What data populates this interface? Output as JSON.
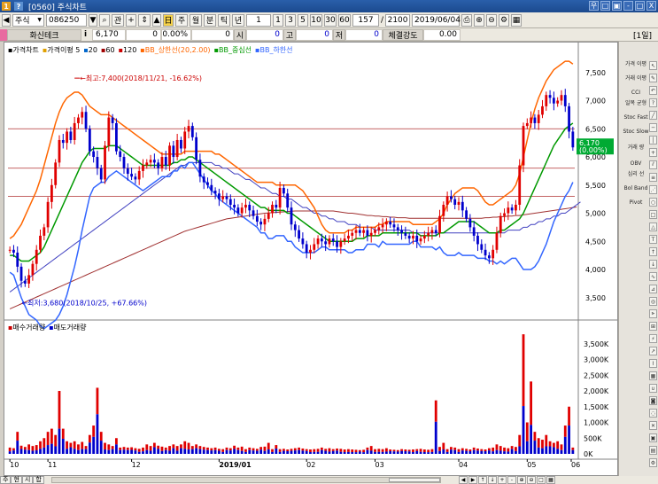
{
  "window": {
    "title": "[0560] 주식차트",
    "icon1": "1",
    "icon2": "?",
    "controls": [
      "우",
      "□",
      "▣",
      "-",
      "□",
      "X"
    ]
  },
  "toolbar1": {
    "market_select": "주식",
    "code": "086250",
    "search_label": "관",
    "btn_prev": "▲",
    "period_buttons": [
      "주",
      "월",
      "분",
      "틱",
      "년"
    ],
    "interval_value": "1",
    "interval_buttons": [
      "1",
      "3",
      "5",
      "10",
      "30",
      "60"
    ],
    "count_value": "157",
    "total_value": "2100",
    "date_value": "2019/06/04"
  },
  "toolbar2": {
    "name": "화신테크",
    "info_icon": "i",
    "price": "6,170",
    "change": "0",
    "change_pct": "0.00%",
    "volume": "0",
    "open_label": "시",
    "open_value": "0",
    "high_label": "고",
    "high_value": "0",
    "low_label": "저",
    "low_value": "0",
    "strength_label": "체결강도",
    "strength_value": "0.00",
    "period_badge": "[1일]"
  },
  "legend": {
    "items": [
      "가격차트",
      "가격이평 5",
      "20",
      "60",
      "120",
      "BB_상한선(20,2.00)",
      "BB_중심선",
      "BB_하한선"
    ],
    "colors": [
      "#000000",
      "#e0a000",
      "#0066cc",
      "#a00000",
      "#cc0000",
      "#ff6600",
      "#009900",
      "#3366ff"
    ]
  },
  "annotations": {
    "high": "최고:7,400(2018/11/21, -16.62%)",
    "low": "최저:3,680(2018/10/25, +67.66%)",
    "current_price": "6,170",
    "current_pct": "(0.00%)"
  },
  "price_axis": [
    "7,500",
    "7,000",
    "6,500",
    "6,000",
    "5,500",
    "5,000",
    "4,500",
    "4,000",
    "3,500"
  ],
  "volume_axis": [
    "3,500K",
    "3,000K",
    "2,500K",
    "2,000K",
    "1,500K",
    "1,000K",
    "500K",
    "0K"
  ],
  "volume_legend": [
    "매수거래량",
    "매도거래량"
  ],
  "x_axis": [
    "10",
    "11",
    "12",
    "2019/01",
    "02",
    "03",
    "04",
    "05",
    "06"
  ],
  "right_panel": {
    "items": [
      "가격 이평",
      "거래 이평",
      "CCI",
      "일목 균형",
      "Stoc Fast",
      "Stoc Slow",
      "거래 량",
      "OBV",
      "심리 선",
      "Bol Band",
      "Pivot"
    ]
  },
  "bottom": {
    "tabs": [
      "주",
      "현",
      "시",
      "합"
    ],
    "controls": [
      "◀",
      "▶",
      "↑",
      "↓",
      "+",
      "-",
      "⊕",
      "⊖",
      "□",
      "▦"
    ]
  },
  "chart_data": {
    "type": "candlestick",
    "title": "",
    "ylim": [
      3150,
      7780
    ],
    "volume_ylim": [
      0,
      4000
    ],
    "x_labels": [
      "10",
      "11",
      "12",
      "2019/01",
      "02",
      "03",
      "04",
      "05",
      "06"
    ],
    "closes": [
      4350,
      4300,
      4050,
      3800,
      3750,
      3900,
      4100,
      4350,
      4600,
      4750,
      5200,
      5500,
      5900,
      6300,
      6250,
      6450,
      6300,
      6600,
      6700,
      6800,
      6500,
      6100,
      6000,
      5800,
      5600,
      6200,
      6700,
      6600,
      6100,
      6000,
      5800,
      5700,
      5650,
      5600,
      5750,
      5850,
      5900,
      5950,
      5900,
      5800,
      6000,
      5850,
      6200,
      6000,
      6300,
      6150,
      6450,
      6550,
      6350,
      5950,
      5650,
      5550,
      5500,
      5400,
      5350,
      5250,
      5300,
      5250,
      5150,
      5100,
      5000,
      5100,
      5150,
      5050,
      4950,
      4850,
      4800,
      4900,
      5000,
      5150,
      5100,
      5450,
      5350,
      5100,
      4800,
      4700,
      4550,
      4450,
      4300,
      4350,
      4450,
      4550,
      4500,
      4450,
      4550,
      4500,
      4400,
      4500,
      4550,
      4600,
      4650,
      4700,
      4650,
      4700,
      4600,
      4650,
      4700,
      4750,
      4800,
      4850,
      4800,
      4750,
      4700,
      4650,
      4600,
      4550,
      4600,
      4500,
      4550,
      4600,
      4650,
      4700,
      4650,
      4950,
      5150,
      5300,
      5250,
      5150,
      5200,
      5050,
      4900,
      4750,
      4600,
      4450,
      4350,
      4250,
      4200,
      4350,
      4650,
      4950,
      5000,
      5100,
      5050,
      5150,
      5850,
      6550,
      6600,
      6700,
      6600,
      6750,
      6900,
      7100,
      7050,
      6950,
      7000,
      7100,
      6900,
      6450,
      6170
    ],
    "volumes": [
      200,
      180,
      700,
      260,
      220,
      300,
      250,
      280,
      400,
      500,
      700,
      800,
      600,
      2000,
      800,
      400,
      350,
      400,
      300,
      380,
      250,
      600,
      900,
      2100,
      700,
      350,
      300,
      250,
      500,
      200,
      220,
      200,
      210,
      180,
      160,
      200,
      300,
      250,
      350,
      260,
      230,
      200,
      250,
      300,
      250,
      300,
      400,
      350,
      250,
      300,
      250,
      220,
      200,
      180,
      200,
      160,
      150,
      200,
      180,
      260,
      200,
      230,
      150,
      200,
      180,
      160,
      220,
      230,
      350,
      150,
      280,
      150,
      160,
      140,
      160,
      180,
      200,
      170,
      150,
      140,
      150,
      160,
      200,
      160,
      180,
      150,
      170,
      160,
      140,
      150,
      140,
      130,
      120,
      130,
      200,
      250,
      150,
      160,
      150,
      180,
      140,
      130,
      120,
      150,
      140,
      130,
      140,
      150,
      160,
      140,
      130,
      150,
      1700,
      220,
      350,
      150,
      220,
      200,
      150,
      180,
      160,
      140,
      200,
      170,
      150,
      140,
      180,
      200,
      300,
      250,
      200,
      180,
      250,
      220,
      600,
      3800,
      1000,
      2300,
      700,
      500,
      450,
      600,
      400,
      350,
      400,
      300,
      900,
      1500,
      200
    ],
    "bb_upper": [
      4550,
      4600,
      4700,
      4800,
      4950,
      5100,
      5250,
      5400,
      5600,
      5850,
      6100,
      6350,
      6600,
      6800,
      6950,
      7050,
      7100,
      7150,
      7150,
      7100,
      7000,
      6900,
      6850,
      6800,
      6750,
      6750,
      6750,
      6700,
      6650,
      6600,
      6550,
      6500,
      6450,
      6400,
      6350,
      6300,
      6250,
      6200,
      6150,
      6100,
      6050,
      6050,
      6050,
      6050,
      6050,
      6050,
      6100,
      6100,
      6100,
      6100,
      6100,
      6100,
      6100,
      6100,
      6050,
      6050,
      6000,
      5950,
      5900,
      5850,
      5800,
      5750,
      5700,
      5650,
      5600,
      5550,
      5550,
      5550,
      5550,
      5550,
      5500,
      5500,
      5500,
      5500,
      5500,
      5500,
      5450,
      5400,
      5300,
      5200,
      5100,
      4950,
      4800,
      4700,
      4650,
      4650,
      4650,
      4650,
      4650,
      4700,
      4700,
      4750,
      4750,
      4750,
      4750,
      4750,
      4750,
      4800,
      4800,
      4850,
      4850,
      4850,
      4850,
      4850,
      4850,
      4850,
      4800,
      4800,
      4800,
      4800,
      4800,
      4800,
      4850,
      4900,
      5000,
      5150,
      5250,
      5350,
      5400,
      5450,
      5450,
      5450,
      5450,
      5400,
      5300,
      5200,
      5150,
      5150,
      5200,
      5250,
      5300,
      5350,
      5400,
      5500,
      5700,
      6000,
      6300,
      6600,
      6850,
      7050,
      7200,
      7350,
      7450,
      7550,
      7600,
      7650,
      7700,
      7700,
      7650
    ],
    "bb_mid": [
      4250,
      4250,
      4200,
      4150,
      4150,
      4150,
      4200,
      4250,
      4300,
      4400,
      4550,
      4700,
      4850,
      5000,
      5150,
      5300,
      5450,
      5600,
      5750,
      5900,
      6000,
      6100,
      6150,
      6150,
      6150,
      6150,
      6200,
      6200,
      6200,
      6150,
      6100,
      6050,
      6000,
      5950,
      5900,
      5850,
      5850,
      5850,
      5850,
      5850,
      5850,
      5850,
      5850,
      5900,
      5900,
      5950,
      5950,
      6000,
      6000,
      5950,
      5900,
      5850,
      5800,
      5750,
      5700,
      5650,
      5600,
      5550,
      5500,
      5450,
      5400,
      5350,
      5300,
      5250,
      5200,
      5150,
      5100,
      5100,
      5050,
      5050,
      5050,
      5050,
      5050,
      5000,
      5000,
      4950,
      4900,
      4850,
      4800,
      4750,
      4700,
      4650,
      4600,
      4550,
      4500,
      4500,
      4500,
      4500,
      4500,
      4500,
      4500,
      4550,
      4550,
      4550,
      4600,
      4600,
      4600,
      4600,
      4650,
      4650,
      4650,
      4650,
      4650,
      4650,
      4650,
      4650,
      4650,
      4650,
      4600,
      4600,
      4600,
      4600,
      4600,
      4650,
      4650,
      4700,
      4750,
      4800,
      4850,
      4850,
      4850,
      4850,
      4850,
      4800,
      4750,
      4700,
      4650,
      4650,
      4650,
      4700,
      4700,
      4750,
      4800,
      4850,
      4900,
      5000,
      5150,
      5300,
      5450,
      5600,
      5750,
      5900,
      6050,
      6200,
      6300,
      6400,
      6500,
      6550,
      6600
    ],
    "bb_lower": [
      3950,
      3900,
      3700,
      3500,
      3350,
      3200,
      3150,
      3100,
      3000,
      2950,
      3000,
      3050,
      3100,
      3200,
      3350,
      3550,
      3800,
      4050,
      4350,
      4700,
      5000,
      5300,
      5450,
      5500,
      5550,
      5550,
      5650,
      5700,
      5750,
      5700,
      5650,
      5600,
      5550,
      5500,
      5450,
      5400,
      5450,
      5500,
      5550,
      5600,
      5650,
      5650,
      5650,
      5750,
      5750,
      5850,
      5800,
      5900,
      5900,
      5800,
      5700,
      5600,
      5500,
      5400,
      5350,
      5250,
      5200,
      5150,
      5100,
      5050,
      5000,
      4950,
      4900,
      4850,
      4800,
      4750,
      4650,
      4650,
      4550,
      4550,
      4600,
      4600,
      4600,
      4500,
      4500,
      4400,
      4350,
      4300,
      4300,
      4300,
      4300,
      4350,
      4400,
      4400,
      4350,
      4350,
      4350,
      4350,
      4350,
      4300,
      4300,
      4350,
      4350,
      4350,
      4450,
      4450,
      4450,
      4400,
      4500,
      4450,
      4450,
      4450,
      4450,
      4450,
      4450,
      4450,
      4500,
      4500,
      4400,
      4400,
      4400,
      4400,
      4350,
      4400,
      4300,
      4250,
      4250,
      4250,
      4300,
      4250,
      4250,
      4250,
      4250,
      4200,
      4200,
      4200,
      4150,
      4150,
      4100,
      4150,
      4100,
      4150,
      4200,
      4200,
      4100,
      4000,
      4000,
      4000,
      4050,
      4150,
      4300,
      4450,
      4650,
      4850,
      5000,
      5150,
      5300,
      5400,
      5550
    ],
    "ma60": [
      3600,
      3650,
      3700,
      3750,
      3800,
      3850,
      3900,
      3950,
      4000,
      4050,
      4100,
      4150,
      4200,
      4250,
      4300,
      4350,
      4400,
      4450,
      4500,
      4550,
      4600,
      4650,
      4700,
      4750,
      4800,
      4850,
      4900,
      4950,
      5000,
      5050,
      5100,
      5150,
      5200,
      5250,
      5300,
      5350,
      5400,
      5450,
      5500,
      5550,
      5600,
      5650,
      5700,
      5750,
      5800,
      5850,
      5850,
      5900,
      5900,
      5900,
      5900,
      5900,
      5900,
      5900,
      5850,
      5850,
      5800,
      5800,
      5750,
      5700,
      5700,
      5650,
      5600,
      5600,
      5550,
      5500,
      5450,
      5450,
      5400,
      5350,
      5350,
      5300,
      5300,
      5250,
      5250,
      5200,
      5150,
      5100,
      5100,
      5050,
      5000,
      5000,
      4950,
      4950,
      4900,
      4900,
      4850,
      4850,
      4850,
      4800,
      4800,
      4800,
      4750,
      4750,
      4750,
      4750,
      4700,
      4700,
      4700,
      4700,
      4700,
      4700,
      4700,
      4700,
      4700,
      4700,
      4650,
      4650,
      4650,
      4650,
      4650,
      4650,
      4650,
      4650,
      4650,
      4650,
      4650,
      4650,
      4650,
      4650,
      4650,
      4650,
      4650,
      4650,
      4650,
      4650,
      4650,
      4650,
      4650,
      4650,
      4650,
      4700,
      4700,
      4700,
      4700,
      4750,
      4750,
      4800,
      4800,
      4850,
      4850,
      4900,
      4900,
      4950,
      4950,
      5000,
      5000,
      5050,
      5100,
      5150,
      5200
    ],
    "ma120": [
      3300,
      3330,
      3360,
      3390,
      3420,
      3450,
      3480,
      3510,
      3540,
      3570,
      3600,
      3630,
      3660,
      3690,
      3720,
      3750,
      3780,
      3810,
      3840,
      3870,
      3900,
      3930,
      3960,
      3990,
      4020,
      4050,
      4080,
      4110,
      4140,
      4170,
      4200,
      4230,
      4260,
      4290,
      4320,
      4350,
      4380,
      4410,
      4440,
      4470,
      4500,
      4530,
      4560,
      4590,
      4620,
      4650,
      4680,
      4700,
      4720,
      4740,
      4760,
      4780,
      4800,
      4820,
      4840,
      4860,
      4880,
      4900,
      4910,
      4920,
      4930,
      4940,
      4950,
      4960,
      4970,
      4980,
      4990,
      5000,
      5005,
      5010,
      5015,
      5020,
      5025,
      5030,
      5035,
      5040,
      5040,
      5040,
      5040,
      5040,
      5040,
      5040,
      5040,
      5040,
      5040,
      5040,
      5030,
      5020,
      5010,
      5000,
      5000,
      4990,
      4980,
      4970,
      4960,
      4960,
      4950,
      4950,
      4940,
      4940,
      4930,
      4930,
      4920,
      4920,
      4920,
      4910,
      4910,
      4910,
      4910,
      4910,
      4910,
      4910,
      4910,
      4910,
      4910,
      4910,
      4910,
      4910,
      4910,
      4910,
      4910,
      4910,
      4910,
      4910,
      4910,
      4920,
      4920,
      4930,
      4930,
      4940,
      4940,
      4950,
      4950,
      4960,
      4960,
      4970,
      4980,
      4990,
      5000,
      5010,
      5020,
      5030,
      5040,
      5050,
      5060,
      5070,
      5080,
      5090,
      5100,
      5110
    ]
  }
}
